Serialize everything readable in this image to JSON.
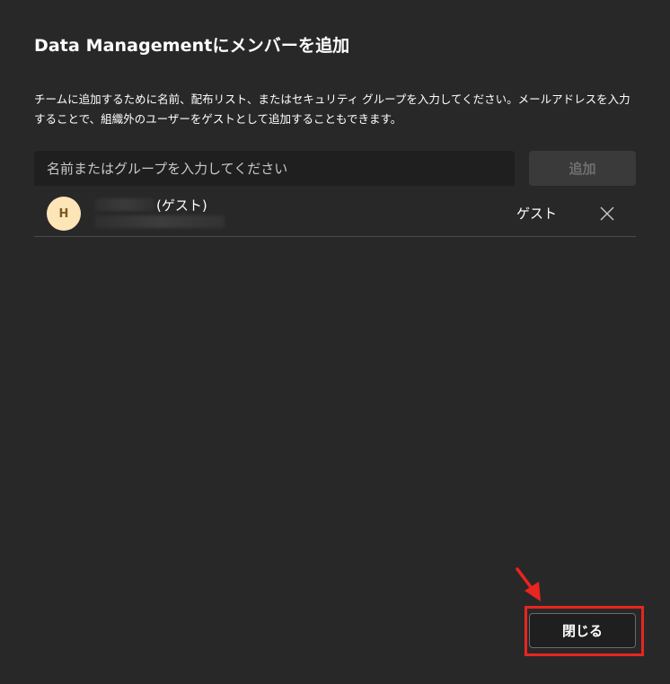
{
  "dialog": {
    "title": "Data Managementにメンバーを追加",
    "description": "チームに追加するために名前、配布リスト、またはセキュリティ グループを入力してください。メールアドレスを入力することで、組織外のユーザーをゲストとして追加することもできます。",
    "search": {
      "placeholder": "名前またはグループを入力してください",
      "value": ""
    },
    "add_label": "追加",
    "members": [
      {
        "avatar_initial": "H",
        "avatar_color": "#fde5b8",
        "name_suffix": "(ゲスト)",
        "role": "ゲスト",
        "remove_icon": "close-icon"
      }
    ],
    "close_label": "閉じる"
  },
  "annotation": {
    "highlight_color": "#e8251f",
    "arrow_icon": "red-arrow-icon"
  }
}
